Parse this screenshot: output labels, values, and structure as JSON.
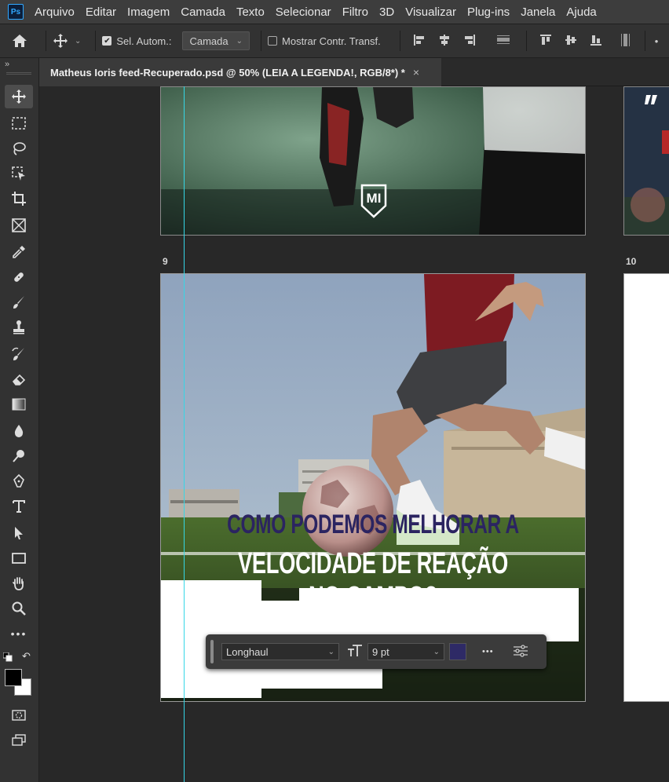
{
  "app": {
    "logo": "Ps"
  },
  "menu": [
    "Arquivo",
    "Editar",
    "Imagem",
    "Camada",
    "Texto",
    "Selecionar",
    "Filtro",
    "3D",
    "Visualizar",
    "Plug-ins",
    "Janela",
    "Ajuda"
  ],
  "options": {
    "auto_select_label": "Sel. Autom.:",
    "auto_select_checked": true,
    "target": "Camada",
    "transform_label": "Mostrar Contr. Transf.",
    "transform_checked": false
  },
  "document_tab": {
    "title": "Matheus Ioris feed-Recuperado.psd @ 50% (LEIA A LEGENDA!, RGB/8*) *",
    "close": "×"
  },
  "artboards": [
    {
      "label": "9"
    },
    {
      "label": "10"
    }
  ],
  "artwork": {
    "logo_text": "MI",
    "headline_line1": "COMO PODEMOS MELHORAR A",
    "headline_line2": "VELOCIDADE DE REAÇÃO NO CAMPO?",
    "headline_line1_color": "#2b2461",
    "headline_line2_color": "#ffffff"
  },
  "contextual_taskbar": {
    "font": "Longhaul",
    "size": "9 pt",
    "color": "#2e2a66",
    "more": "•••"
  },
  "colors": {
    "accent_guide": "#35d6e6",
    "foreground": "#000000",
    "background": "#ffffff"
  }
}
